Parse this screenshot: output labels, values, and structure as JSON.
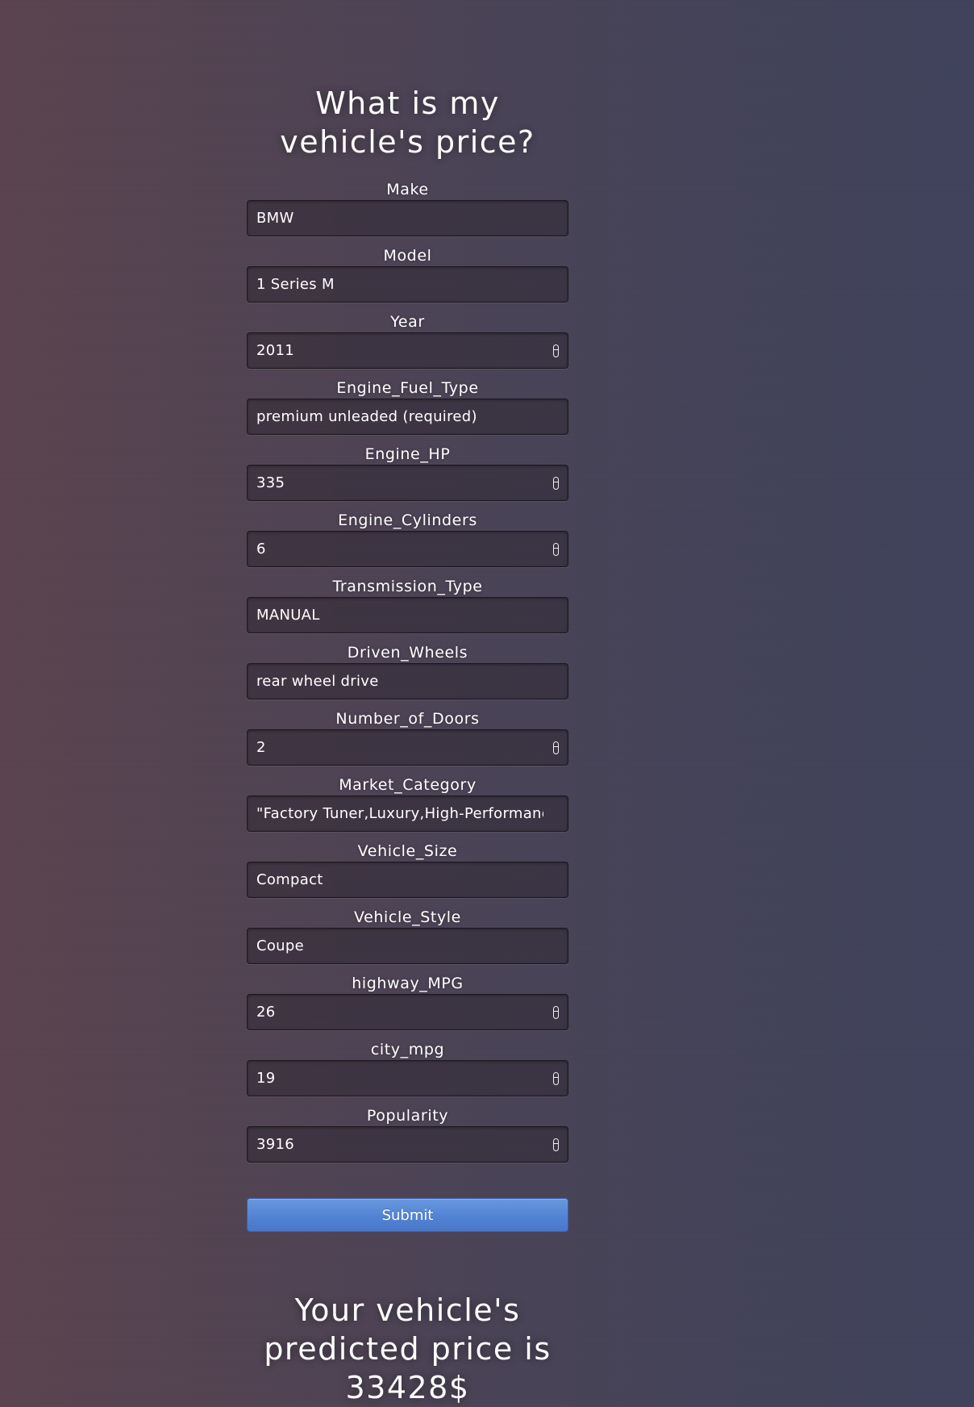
{
  "page": {
    "title": "What is my vehicle's price?"
  },
  "form": {
    "fields": [
      {
        "label": "Make",
        "value": "BMW",
        "stepper": false
      },
      {
        "label": "Model",
        "value": "1 Series M",
        "stepper": false
      },
      {
        "label": "Year",
        "value": "2011",
        "stepper": true
      },
      {
        "label": "Engine_Fuel_Type",
        "value": "premium unleaded (required)",
        "stepper": false
      },
      {
        "label": "Engine_HP",
        "value": "335",
        "stepper": true
      },
      {
        "label": "Engine_Cylinders",
        "value": "6",
        "stepper": true
      },
      {
        "label": "Transmission_Type",
        "value": "MANUAL",
        "stepper": false
      },
      {
        "label": "Driven_Wheels",
        "value": "rear wheel drive",
        "stepper": false
      },
      {
        "label": "Number_of_Doors",
        "value": "2",
        "stepper": true
      },
      {
        "label": "Market_Category",
        "value": "\"Factory Tuner,Luxury,High-Performance\"",
        "stepper": false
      },
      {
        "label": "Vehicle_Size",
        "value": "Compact",
        "stepper": false
      },
      {
        "label": "Vehicle_Style",
        "value": "Coupe",
        "stepper": false
      },
      {
        "label": "highway_MPG",
        "value": "26",
        "stepper": true
      },
      {
        "label": "city_mpg",
        "value": "19",
        "stepper": true
      },
      {
        "label": "Popularity",
        "value": "3916",
        "stepper": true
      }
    ],
    "submit_label": "Submit"
  },
  "result": {
    "text": "Your vehicle's predicted price is 33428$"
  },
  "colors": {
    "background_left": "#5b444f",
    "background_right": "#3f435c",
    "submit_button": "#5283d4",
    "text": "#ffffff"
  }
}
